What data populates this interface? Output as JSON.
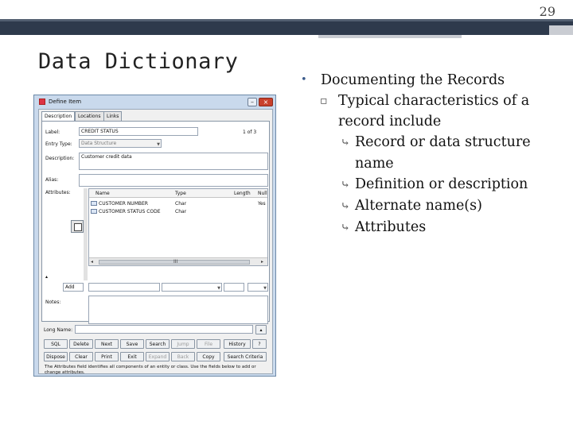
{
  "slide": {
    "page_number": "29",
    "title": "Data Dictionary"
  },
  "bullets": {
    "level1": "Documenting the Records",
    "level2": "Typical characteristics of a record include",
    "level3": [
      "Record or data structure name",
      "Definition or description",
      "Alternate name(s)",
      "Attributes"
    ]
  },
  "dialog": {
    "title": "Define Item",
    "tabs": [
      "Description",
      "Locations",
      "Links"
    ],
    "fields": {
      "label_caption": "Label:",
      "label_value": "CREDIT STATUS",
      "counter": "1 of 3",
      "entry_type_caption": "Entry Type:",
      "entry_type_value": "Data Structure",
      "description_caption": "Description:",
      "description_value": "Customer credit data",
      "alias_caption": "Alias:",
      "attributes_caption": "Attributes:",
      "notes_caption": "Notes:",
      "long_name_caption": "Long Name:"
    },
    "attr_columns": [
      "Name",
      "Type",
      "Length",
      "Null"
    ],
    "attr_rows": [
      {
        "name": "CUSTOMER NUMBER",
        "type": "Char",
        "length": "",
        "null": "Yes"
      },
      {
        "name": "CUSTOMER STATUS CODE",
        "type": "Char",
        "length": "",
        "null": ""
      }
    ],
    "add_label": "Add",
    "scroll_mid": "III",
    "buttons_row1": [
      "SQL",
      "Delete",
      "Next",
      "Save",
      "Search",
      "Jump",
      "File",
      "History",
      "?"
    ],
    "buttons_row2": [
      "Dispose",
      "Clear",
      "Print",
      "Exit",
      "Expand",
      "Back",
      "Copy",
      "Search Criteria"
    ],
    "hint": "The Attributes field identifies all components of an entity or class. Use the fields below to add or change attributes."
  },
  "colors": {
    "title_bar": "#2e3a4c",
    "dialog_frame": "#c9d9ec",
    "bullet_accent": "#3a5a8a"
  },
  "icons": {
    "bullet_level2": "square-bullet-icon",
    "bullet_level3": "curved-arrow-bullet-icon"
  }
}
